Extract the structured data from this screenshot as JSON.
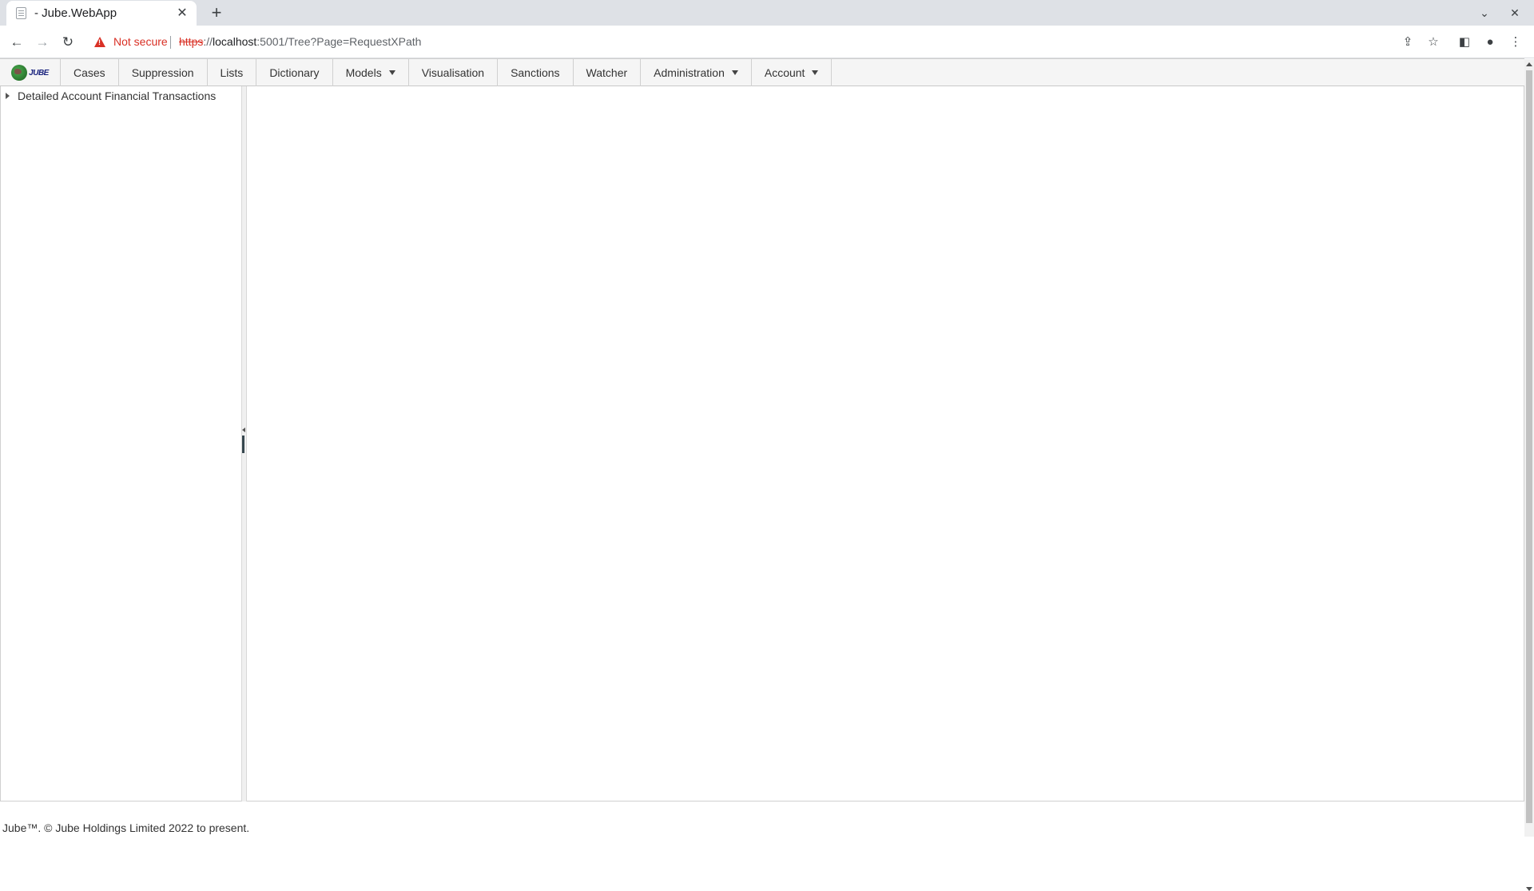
{
  "browser": {
    "tab_title": "- Jube.WebApp",
    "new_tab_icon": "plus-icon",
    "not_secure": "Not secure",
    "url_scheme": "https",
    "url_host": "localhost",
    "url_rest": ":5001/Tree?Page=RequestXPath"
  },
  "app": {
    "logo_text": "JUBE",
    "menu": [
      {
        "label": "Cases",
        "dropdown": false
      },
      {
        "label": "Suppression",
        "dropdown": false
      },
      {
        "label": "Lists",
        "dropdown": false
      },
      {
        "label": "Dictionary",
        "dropdown": false
      },
      {
        "label": "Models",
        "dropdown": true
      },
      {
        "label": "Visualisation",
        "dropdown": false
      },
      {
        "label": "Sanctions",
        "dropdown": false
      },
      {
        "label": "Watcher",
        "dropdown": false
      },
      {
        "label": "Administration",
        "dropdown": true
      },
      {
        "label": "Account",
        "dropdown": true
      }
    ]
  },
  "tree": {
    "nodes": [
      {
        "label": "Detailed Account Financial Transactions",
        "expanded": false
      }
    ]
  },
  "footer": {
    "text": "Jube™. © Jube Holdings Limited 2022 to present."
  }
}
